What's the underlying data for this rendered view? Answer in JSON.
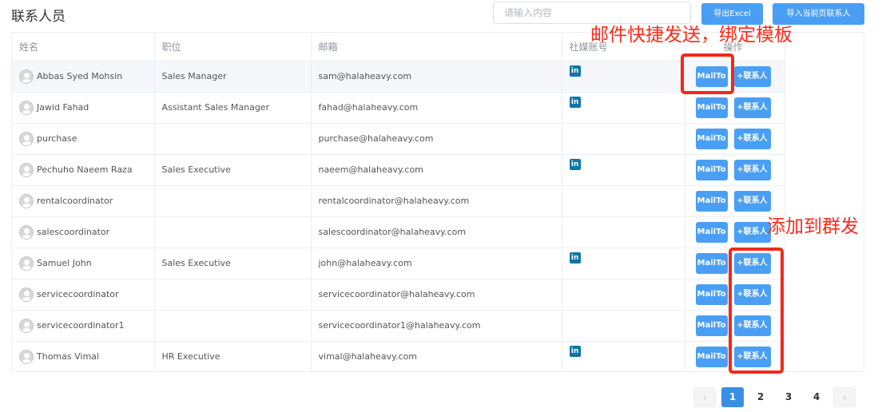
{
  "page_title": "联系人员",
  "search": {
    "placeholder": "请输入内容",
    "value": ""
  },
  "header_buttons": {
    "export_excel": "导出Excel",
    "import_page": "导入当前页联系人"
  },
  "table": {
    "columns": [
      "姓名",
      "职位",
      "邮箱",
      "社媒账号",
      "操作"
    ],
    "rows": [
      {
        "name": "Abbas Syed Mohsin",
        "position": "Sales Manager",
        "email": "sam@halaheavy.com",
        "linkedin": true
      },
      {
        "name": "Jawid Fahad",
        "position": "Assistant Sales Manager",
        "email": "fahad@halaheavy.com",
        "linkedin": true
      },
      {
        "name": "purchase",
        "position": "",
        "email": "purchase@halaheavy.com",
        "linkedin": false
      },
      {
        "name": "Pechuho Naeem Raza",
        "position": "Sales Executive",
        "email": "naeem@halaheavy.com",
        "linkedin": true
      },
      {
        "name": "rentalcoordinator",
        "position": "",
        "email": "rentalcoordinator@halaheavy.com",
        "linkedin": false
      },
      {
        "name": "salescoordinator",
        "position": "",
        "email": "salescoordinator@halaheavy.com",
        "linkedin": false
      },
      {
        "name": "Samuel John",
        "position": "Sales Executive",
        "email": "john@halaheavy.com",
        "linkedin": true
      },
      {
        "name": "servicecoordinator",
        "position": "",
        "email": "servicecoordinator@halaheavy.com",
        "linkedin": false
      },
      {
        "name": "servicecoordinator1",
        "position": "",
        "email": "servicecoordinator1@halaheavy.com",
        "linkedin": false
      },
      {
        "name": "Thomas Vimal",
        "position": "HR Executive",
        "email": "vimal@halaheavy.com",
        "linkedin": true
      }
    ],
    "actions": {
      "mailto": "MailTo",
      "add_contact": "+联系人"
    },
    "linkedin_icon": {
      "name": "linkedin-icon",
      "glyph": "in",
      "color": "#0e76a8"
    }
  },
  "annotations": {
    "mail_note": "邮件快捷发送，绑定模板",
    "group_note": "添加到群发",
    "color": "#ff2a1a"
  },
  "pagination": {
    "pages": [
      "1",
      "2",
      "3",
      "4"
    ],
    "current": "1",
    "prev_icon": "‹",
    "next_icon": "›"
  },
  "colors": {
    "primary": "#4a9ff5",
    "border": "#ebeef5",
    "highlight_row": "#f5f7fa"
  }
}
